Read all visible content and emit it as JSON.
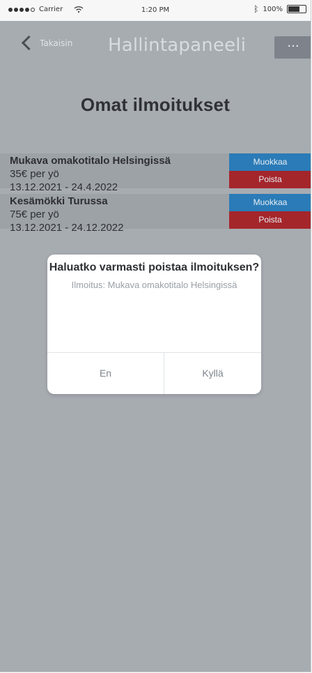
{
  "status_bar": {
    "carrier": "Carrier",
    "time": "1:20 PM",
    "battery": "100%"
  },
  "nav": {
    "back_label": "Takaisin",
    "title": "Hallintapaneeli",
    "more_label": "···"
  },
  "page": {
    "title": "Omat ilmoitukset"
  },
  "listings": [
    {
      "title": "Mukava omakotitalo Helsingissä",
      "price": "35€ per yö",
      "dates": "13.12.2021 - 24.4.2022",
      "edit_label": "Muokkaa",
      "delete_label": "Poista"
    },
    {
      "title": "Kesämökki Turussa",
      "price": "75€ per yö",
      "dates": "13.12.2021 - 24.12.2022",
      "edit_label": "Muokkaa",
      "delete_label": "Poista"
    }
  ],
  "dialog": {
    "title": "Haluatko varmasti poistaa ilmoituksen?",
    "subtitle": "Ilmoitus: Mukava omakotitalo Helsingissä",
    "cancel_label": "En",
    "confirm_label": "Kyllä"
  },
  "colors": {
    "overlay": "#a7acb1",
    "edit": "#2a7bb7",
    "delete": "#a4262b"
  }
}
